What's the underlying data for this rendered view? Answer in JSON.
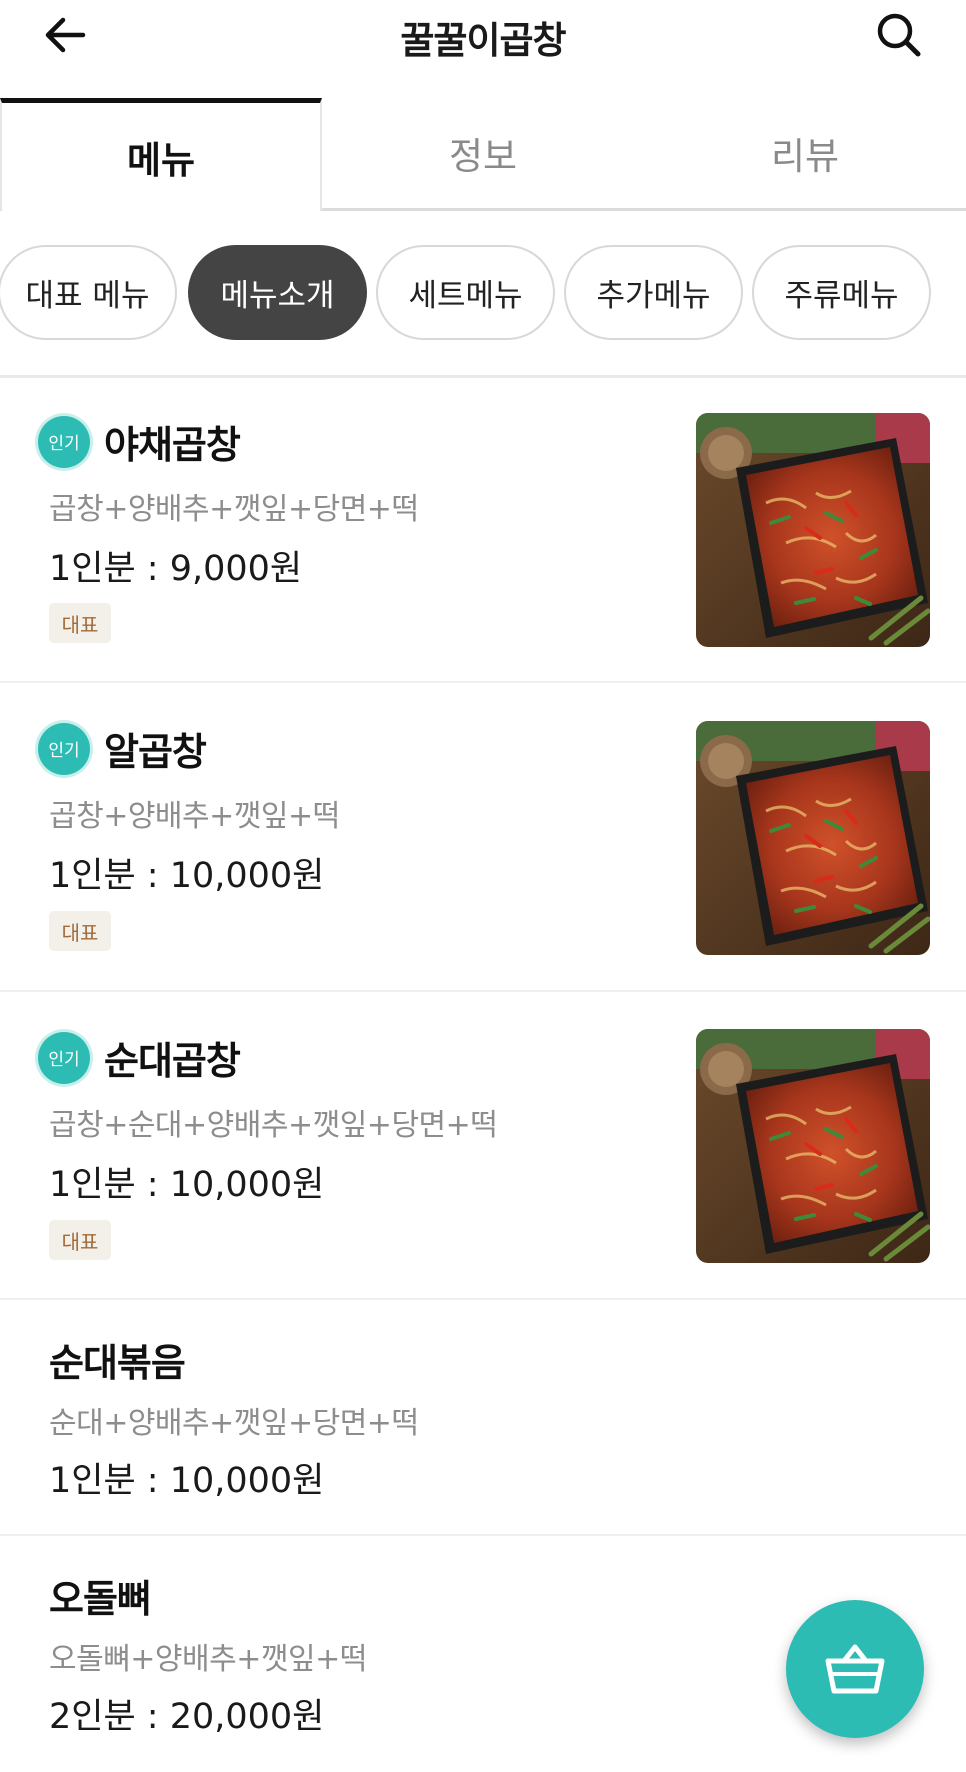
{
  "header": {
    "title": "꿀꿀이곱창",
    "back_icon": "arrow-left-icon",
    "search_icon": "search-icon"
  },
  "tabs": [
    {
      "label": "메뉴",
      "active": true
    },
    {
      "label": "정보",
      "active": false
    },
    {
      "label": "리뷰",
      "active": false
    }
  ],
  "categories": [
    {
      "label": "대표 메뉴",
      "active": false
    },
    {
      "label": "메뉴소개",
      "active": true
    },
    {
      "label": "세트메뉴",
      "active": false
    },
    {
      "label": "추가메뉴",
      "active": false
    },
    {
      "label": "주류메뉴",
      "active": false
    }
  ],
  "menu_items": [
    {
      "popular_badge": "인기",
      "name": "야채곱창",
      "description": "곱창+양배추+깻잎+당면+떡",
      "price": "1인분 : 9,000원",
      "rep_badge": "대표",
      "has_image": true
    },
    {
      "popular_badge": "인기",
      "name": "알곱창",
      "description": "곱창+양배추+깻잎+떡",
      "price": "1인분 : 10,000원",
      "rep_badge": "대표",
      "has_image": true
    },
    {
      "popular_badge": "인기",
      "name": "순대곱창",
      "description": "곱창+순대+양배추+깻잎+당면+떡",
      "price": "1인분 : 10,000원",
      "rep_badge": "대표",
      "has_image": true
    },
    {
      "name": "순대볶음",
      "description": "순대+양배추+깻잎+당면+떡",
      "price": "1인분 : 10,000원",
      "has_image": false
    },
    {
      "name": "오돌뼈",
      "description": "오돌뼈+양배추+깻잎+떡",
      "price": "2인분 : 20,000원",
      "has_image": false
    }
  ],
  "cart": {
    "icon": "shopping-basket-icon"
  },
  "colors": {
    "accent": "#2cbcb3",
    "active_chip": "#444444",
    "rep_badge_bg": "#f3efe9",
    "rep_badge_text": "#a06b3a"
  }
}
